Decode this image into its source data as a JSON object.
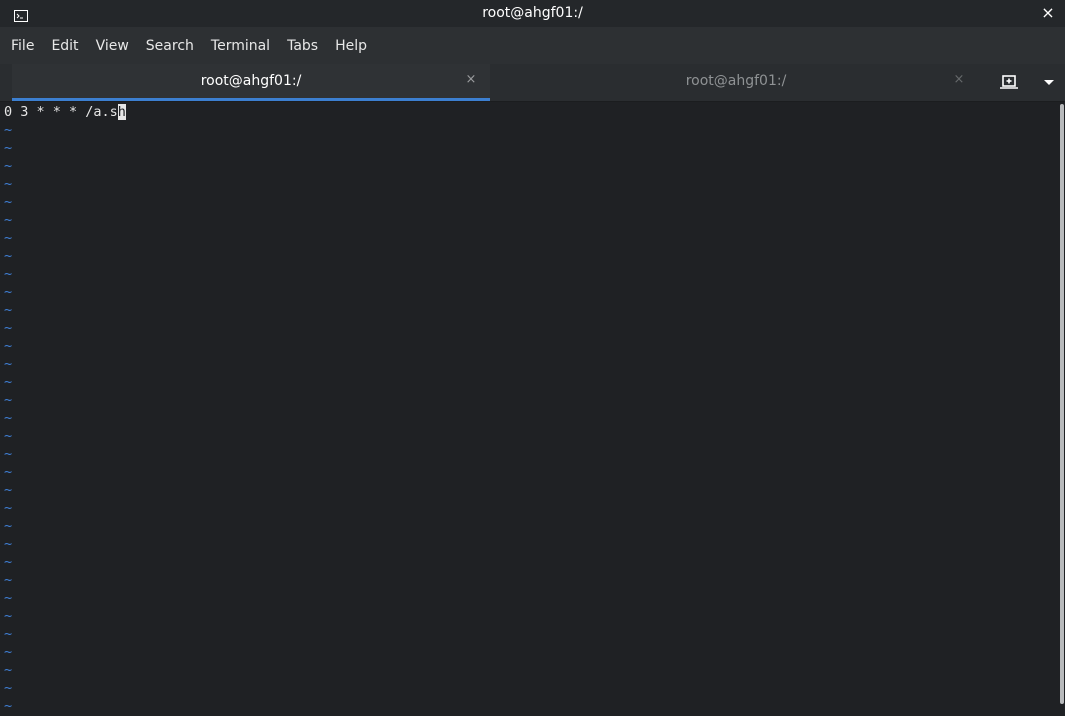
{
  "window": {
    "title": "root@ahgf01:/",
    "close_glyph": "×"
  },
  "menu": {
    "items": [
      "File",
      "Edit",
      "View",
      "Search",
      "Terminal",
      "Tabs",
      "Help"
    ]
  },
  "tabs": [
    {
      "label": "root@ahgf01:/",
      "active": true,
      "close_glyph": "×"
    },
    {
      "label": "root@ahgf01:/",
      "active": false,
      "close_glyph": "×"
    }
  ],
  "terminal": {
    "line1_text": "0 3 * * * /a.s",
    "cursor_char": "h",
    "tilde": "~",
    "empty_line_count": 33
  },
  "icons": {
    "window_icon": "terminal-icon",
    "new_tab": "new-tab-icon",
    "tab_menu": "chevron-down-icon"
  },
  "colors": {
    "accent": "#3c7fd0",
    "tilde": "#3f7fd6",
    "background": "#1f2124"
  }
}
